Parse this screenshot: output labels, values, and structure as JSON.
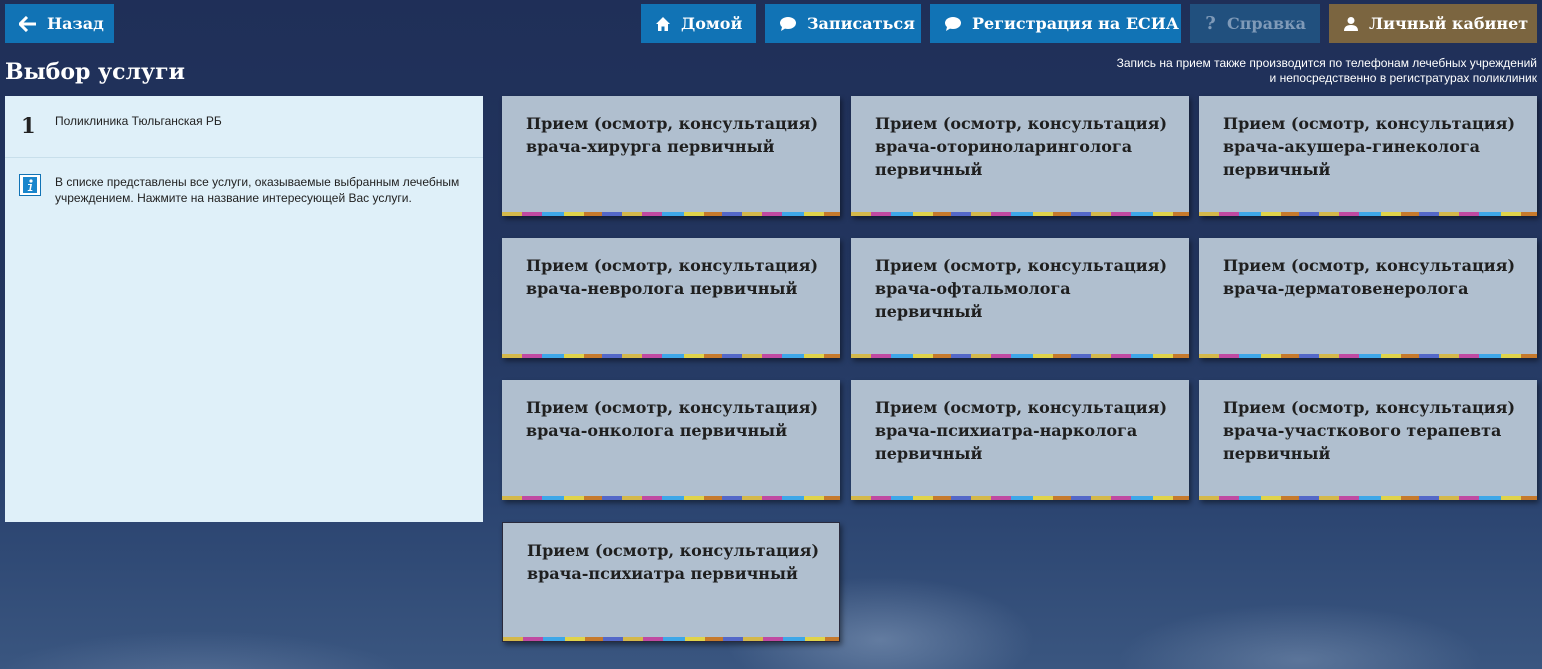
{
  "header": {
    "back_label": "Назад",
    "home_label": "Домой",
    "signup_label": "Записаться",
    "esia_label": "Регистрация на ЕСИА",
    "help_label": "Справка",
    "cabinet_label": "Личный кабинет"
  },
  "page_title": "Выбор услуги",
  "note": {
    "line1": "Запись на прием также производится по телефонам лечебных учреждений",
    "line2": "и непосредственно в регистратурах поликлиник"
  },
  "left_panel": {
    "step_number": "1",
    "clinic_name": "Поликлиника Тюльганская РБ",
    "info_text": "В списке представлены все услуги, оказываемые выбранным лечебным учреждением. Нажмите на название интересующей Вас услуги."
  },
  "services": [
    {
      "title": "Прием (осмотр, консультация) врача-хирурга первичный"
    },
    {
      "title": "Прием (осмотр, консультация) врача-оториноларинголога первичный"
    },
    {
      "title": "Прием (осмотр, консультация) врача-акушера-гинеколога первичный"
    },
    {
      "title": "Прием (осмотр, консультация) врача-невролога первичный"
    },
    {
      "title": "Прием (осмотр, консультация) врача-офтальмолога первичный"
    },
    {
      "title": "Прием (осмотр, консультация) врача-дерматовенеролога"
    },
    {
      "title": "Прием (осмотр, консультация) врача-онколога первичный"
    },
    {
      "title": "Прием (осмотр, консультация) врача-психиатра-нарколога первичный"
    },
    {
      "title": "Прием (осмотр, консультация) врача-участкового терапевта первичный"
    },
    {
      "title": "Прием (осмотр, консультация) врача-психиатра первичный"
    }
  ],
  "icons": {
    "back": "arrow-left-icon",
    "home": "home-icon",
    "signup": "chat-bubble-icon",
    "esia": "chat-bubble-icon",
    "help": "question-icon",
    "cabinet": "user-icon",
    "info": "info-icon"
  },
  "colors": {
    "primary_button": "#1173b5",
    "disabled_button": "#21507e",
    "cabinet_button": "#7b6540",
    "card_bg": "#b0bfcf",
    "panel_bg": "#dff0f9"
  }
}
